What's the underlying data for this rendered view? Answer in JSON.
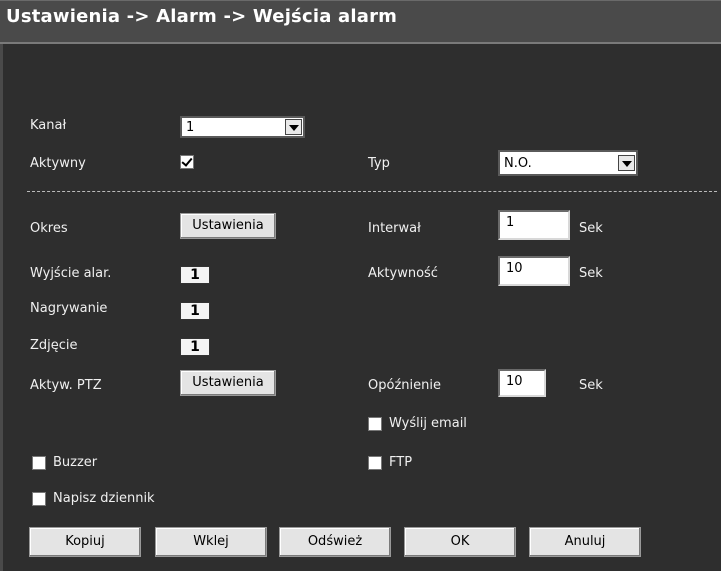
{
  "title": "Ustawienia -> Alarm -> Wejścia alarm",
  "kanal": {
    "label": "Kanał",
    "value": "1"
  },
  "aktywny": {
    "label": "Aktywny",
    "checked": true
  },
  "typ": {
    "label": "Typ",
    "value": "N.O."
  },
  "okres": {
    "label": "Okres",
    "button": "Ustawienia"
  },
  "interwal": {
    "label": "Interwał",
    "value": "1",
    "unit": "Sek"
  },
  "wyjscie": {
    "label": "Wyjście alar.",
    "value": "1"
  },
  "aktywnosc": {
    "label": "Aktywność",
    "value": "10",
    "unit": "Sek"
  },
  "nagrywanie": {
    "label": "Nagrywanie",
    "value": "1"
  },
  "zdjecie": {
    "label": "Zdjęcie",
    "value": "1"
  },
  "ptz": {
    "label": "Aktyw. PTZ",
    "button": "Ustawienia"
  },
  "opoznienie": {
    "label": "Opóźnienie",
    "value": "10",
    "unit": "Sek"
  },
  "email": {
    "label": "Wyślij email",
    "checked": false
  },
  "buzzer": {
    "label": "Buzzer",
    "checked": false
  },
  "ftp": {
    "label": "FTP",
    "checked": false
  },
  "dziennik": {
    "label": "Napisz dziennik",
    "checked": false
  },
  "buttons": {
    "kopiuj": "Kopiuj",
    "wklej": "Wklej",
    "odswiez": "Odśwież",
    "ok": "OK",
    "anuluj": "Anuluj"
  }
}
